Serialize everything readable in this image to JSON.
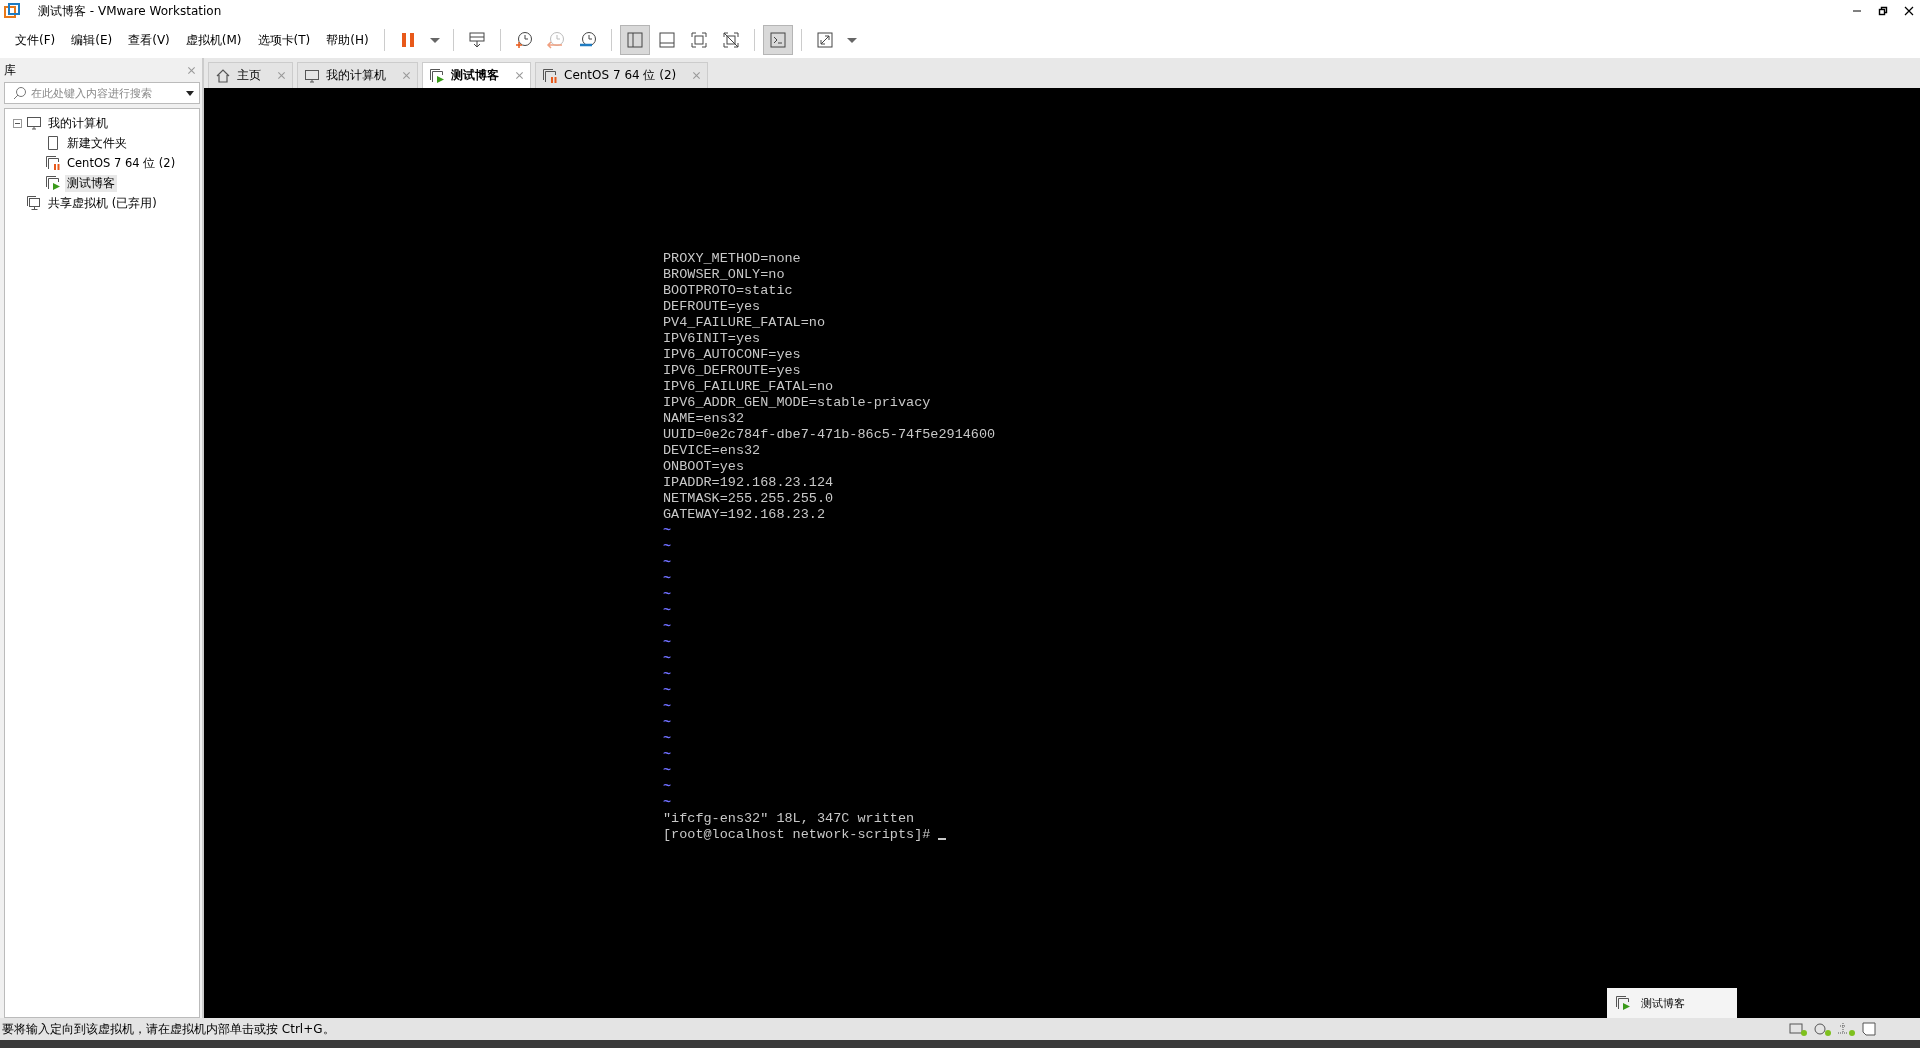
{
  "window": {
    "title": "测试博客 - VMware Workstation"
  },
  "menu": [
    "文件(F)",
    "编辑(E)",
    "查看(V)",
    "虚拟机(M)",
    "选项卡(T)",
    "帮助(H)"
  ],
  "toolbar": [
    {
      "kind": "pause",
      "pressed": false
    },
    {
      "kind": "caret",
      "pressed": false
    },
    {
      "kind": "sep"
    },
    {
      "kind": "send-keys",
      "pressed": false
    },
    {
      "kind": "sep"
    },
    {
      "kind": "snapshot-take",
      "pressed": false
    },
    {
      "kind": "snapshot-revert",
      "pressed": false
    },
    {
      "kind": "snapshot-manage",
      "pressed": false
    },
    {
      "kind": "sep"
    },
    {
      "kind": "view-library",
      "pressed": true
    },
    {
      "kind": "view-thumbs",
      "pressed": false
    },
    {
      "kind": "view-full",
      "pressed": false
    },
    {
      "kind": "view-unity",
      "pressed": false
    },
    {
      "kind": "sep"
    },
    {
      "kind": "console",
      "pressed": true
    },
    {
      "kind": "sep"
    },
    {
      "kind": "stretch",
      "pressed": false
    },
    {
      "kind": "caret",
      "pressed": false
    }
  ],
  "library": {
    "title": "库",
    "search": {
      "placeholder": "在此处键入内容进行搜索"
    },
    "tree": [
      {
        "label": "我的计算机",
        "kind": "computer",
        "expanded": true,
        "selected": false,
        "children": [
          {
            "label": "新建文件夹",
            "kind": "folder",
            "selected": false
          },
          {
            "label": "CentOS 7 64 位 (2)",
            "kind": "vm-paused",
            "selected": false
          },
          {
            "label": "测试博客",
            "kind": "vm-running",
            "selected": true
          }
        ]
      },
      {
        "label": "共享虚拟机 (已弃用)",
        "kind": "shared",
        "selected": false
      }
    ]
  },
  "tabs": [
    {
      "label": "主页",
      "kind": "home",
      "selected": false
    },
    {
      "label": "我的计算机",
      "kind": "computer",
      "selected": false
    },
    {
      "label": "测试博客",
      "kind": "vm-running",
      "selected": true
    },
    {
      "label": "CentOS 7 64 位 (2)",
      "kind": "vm-paused",
      "selected": false
    }
  ],
  "console": {
    "lines": [
      {
        "kind": "text",
        "text": "PROXY_METHOD=none"
      },
      {
        "kind": "text",
        "text": "BROWSER_ONLY=no"
      },
      {
        "kind": "text",
        "text": "BOOTPROTO=static"
      },
      {
        "kind": "text",
        "text": "DEFROUTE=yes"
      },
      {
        "kind": "text",
        "text": "PV4_FAILURE_FATAL=no"
      },
      {
        "kind": "text",
        "text": "IPV6INIT=yes"
      },
      {
        "kind": "text",
        "text": "IPV6_AUTOCONF=yes"
      },
      {
        "kind": "text",
        "text": "IPV6_DEFROUTE=yes"
      },
      {
        "kind": "text",
        "text": "IPV6_FAILURE_FATAL=no"
      },
      {
        "kind": "text",
        "text": "IPV6_ADDR_GEN_MODE=stable-privacy"
      },
      {
        "kind": "text",
        "text": "NAME=ens32"
      },
      {
        "kind": "text",
        "text": "UUID=0e2c784f-dbe7-471b-86c5-74f5e2914600"
      },
      {
        "kind": "text",
        "text": "DEVICE=ens32"
      },
      {
        "kind": "text",
        "text": "ONBOOT=yes"
      },
      {
        "kind": "text",
        "text": "IPADDR=192.168.23.124"
      },
      {
        "kind": "text",
        "text": "NETMASK=255.255.255.0"
      },
      {
        "kind": "text",
        "text": "GATEWAY=192.168.23.2"
      },
      {
        "kind": "tilde",
        "text": "~"
      },
      {
        "kind": "tilde",
        "text": "~"
      },
      {
        "kind": "tilde",
        "text": "~"
      },
      {
        "kind": "tilde",
        "text": "~"
      },
      {
        "kind": "tilde",
        "text": "~"
      },
      {
        "kind": "tilde",
        "text": "~"
      },
      {
        "kind": "tilde",
        "text": "~"
      },
      {
        "kind": "tilde",
        "text": "~"
      },
      {
        "kind": "tilde",
        "text": "~"
      },
      {
        "kind": "tilde",
        "text": "~"
      },
      {
        "kind": "tilde",
        "text": "~"
      },
      {
        "kind": "tilde",
        "text": "~"
      },
      {
        "kind": "tilde",
        "text": "~"
      },
      {
        "kind": "tilde",
        "text": "~"
      },
      {
        "kind": "tilde",
        "text": "~"
      },
      {
        "kind": "tilde",
        "text": "~"
      },
      {
        "kind": "tilde",
        "text": "~"
      },
      {
        "kind": "tilde",
        "text": "~"
      },
      {
        "kind": "text",
        "text": "\"ifcfg-ens32\" 18L, 347C written"
      },
      {
        "kind": "prompt",
        "text": "[root@localhost network-scripts]# "
      }
    ]
  },
  "tooltip": {
    "label": "测试博客"
  },
  "status_bar": {
    "text": "要将输入定向到该虚拟机，请在虚拟机内部单击或按 Ctrl+G。"
  }
}
